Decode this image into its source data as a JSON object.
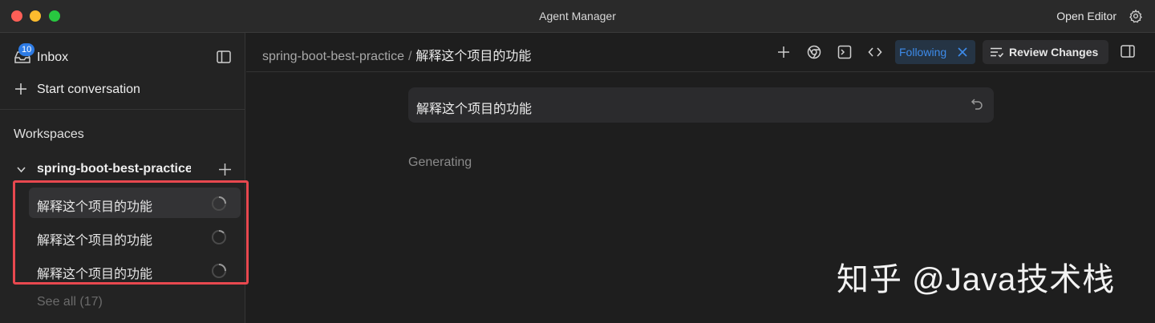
{
  "window": {
    "title": "Agent Manager",
    "open_editor_label": "Open Editor"
  },
  "sidebar": {
    "inbox": {
      "label": "Inbox",
      "badge_count": "10"
    },
    "start_conversation_label": "Start conversation",
    "workspaces_heading": "Workspaces",
    "workspace": {
      "name": "spring-boot-best-practice",
      "conversations": [
        {
          "title": "解释这个项目的功能",
          "status": "loading",
          "active": true
        },
        {
          "title": "解释这个项目的功能",
          "status": "loading",
          "active": false
        },
        {
          "title": "解释这个项目的功能",
          "status": "loading",
          "active": false
        }
      ],
      "see_all_label": "See all (17)"
    }
  },
  "header": {
    "breadcrumb_workspace": "spring-boot-best-practice",
    "breadcrumb_separator": "/",
    "breadcrumb_current": "解释这个项目的功能",
    "icons": [
      "plus-icon",
      "chrome-icon",
      "terminal-icon",
      "code-icon"
    ],
    "following_label": "Following",
    "review_changes_label": "Review Changes"
  },
  "conversation": {
    "user_message": "解释这个项目的功能",
    "status_text": "Generating"
  },
  "watermark": "知乎 @Java技术栈",
  "colors": {
    "accent": "#3d8bea",
    "badge": "#2d7be5",
    "highlight": "#e8484f",
    "background": "#1e1e1e",
    "sidebar": "#232323"
  }
}
